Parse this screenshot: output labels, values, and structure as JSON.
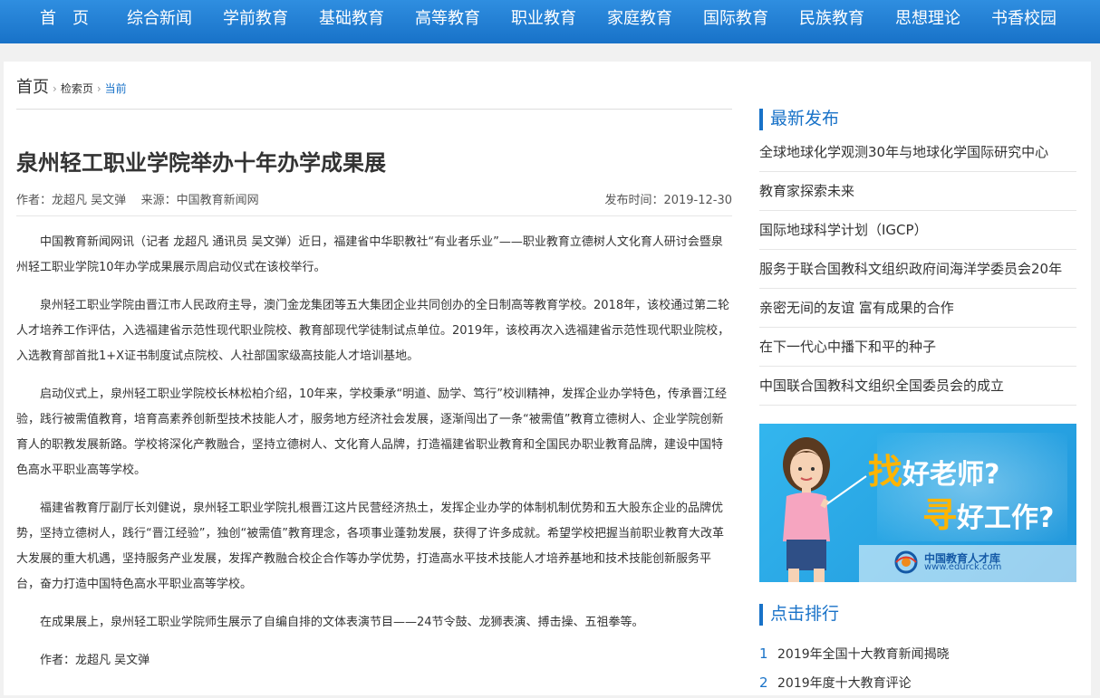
{
  "nav": [
    "首　页",
    "综合新闻",
    "学前教育",
    "基础教育",
    "高等教育",
    "职业教育",
    "家庭教育",
    "国际教育",
    "民族教育",
    "思想理论",
    "书香校园"
  ],
  "breadcrumb": {
    "home": "首页",
    "search": "检索页",
    "current": "当前",
    "sep": "›"
  },
  "article": {
    "title": "泉州轻工职业学院举办十年办学成果展",
    "author_line": "作者：龙超凡 吴文弹",
    "source_line": "来源：中国教育新闻网",
    "date_line": "发布时间：2019-12-30",
    "paragraphs": [
      "中国教育新闻网讯（记者 龙超凡 通讯员 吴文弹）近日，福建省中华职教社“有业者乐业”——职业教育立德树人文化育人研讨会暨泉州轻工职业学院10年办学成果展示周启动仪式在该校举行。",
      "泉州轻工职业学院由晋江市人民政府主导，澳门金龙集团等五大集团企业共同创办的全日制高等教育学校。2018年，该校通过第二轮人才培养工作评估，入选福建省示范性现代职业院校、教育部现代学徒制试点单位。2019年，该校再次入选福建省示范性现代职业院校，入选教育部首批1+X证书制度试点院校、人社部国家级高技能人才培训基地。",
      "启动仪式上，泉州轻工职业学院校长林松柏介绍，10年来，学校秉承“明道、励学、笃行”校训精神，发挥企业办学特色，传承晋江经验，践行被需值教育，培育高素养创新型技术技能人才，服务地方经济社会发展，逐渐闯出了一条“被需值”教育立德树人、企业学院创新育人的职教发展新路。学校将深化产教融合，坚持立德树人、文化育人品牌，打造福建省职业教育和全国民办职业教育品牌，建设中国特色高水平职业高等学校。",
      "福建省教育厅副厅长刘健说，泉州轻工职业学院扎根晋江这片民营经济热土，发挥企业办学的体制机制优势和五大股东企业的品牌优势，坚持立德树人，践行“晋江经验”，独创“被需值”教育理念，各项事业蓬勃发展，获得了许多成就。希望学校把握当前职业教育大改革大发展的重大机遇，坚持服务产业发展，发挥产教融合校企合作等办学优势，打造高水平技术技能人才培养基地和技术技能创新服务平台，奋力打造中国特色高水平职业高等学校。",
      "在成果展上，泉州轻工职业学院师生展示了自编自排的文体表演节目——24节令鼓、龙狮表演、搏击操、五祖拳等。",
      "作者：龙超凡 吴文弹"
    ]
  },
  "sidebar": {
    "latest_title": "最新发布",
    "latest": [
      "全球地球化学观测30年与地球化学国际研究中心",
      "教育家探索未来",
      "国际地球科学计划（IGCP）",
      "服务于联合国教科文组织政府间海洋学委员会20年",
      "亲密无间的友谊 富有成果的合作",
      "在下一代心中播下和平的种子",
      "中国联合国教科文组织全国委员会的成立"
    ],
    "banner": {
      "line1_big": "找",
      "line1_rest": "好老师?",
      "line2_big": "寻",
      "line2_rest": "好工作?",
      "logo_name": "中国教育人才库",
      "logo_url": "www.edurck.com"
    },
    "rank_title": "点击排行",
    "rank": [
      {
        "num": "1",
        "text": "2019年全国十大教育新闻揭晓"
      },
      {
        "num": "2",
        "text": "2019年度十大教育评论"
      }
    ]
  },
  "colors": {
    "nav_bg": "#1872c8",
    "accent": "#1872c8",
    "banner_bg": "#2ba6e6",
    "banner_highlight": "#ffb400"
  }
}
